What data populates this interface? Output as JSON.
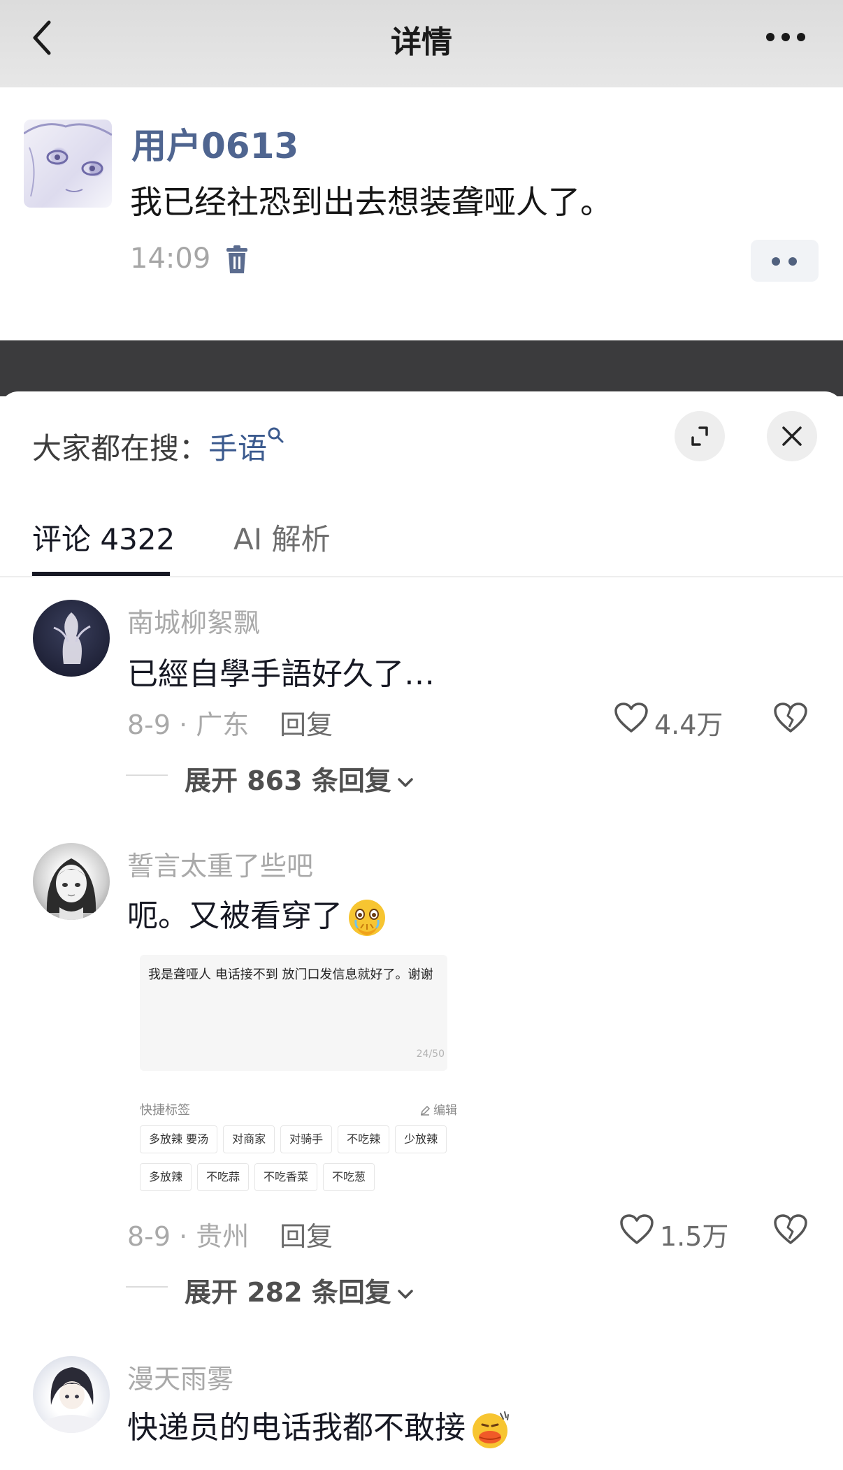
{
  "nav": {
    "title": "详情"
  },
  "post": {
    "username": "用户0613",
    "text": "我已经社恐到出去想装聋哑人了。",
    "time": "14:09"
  },
  "sheet": {
    "hot_search_prefix": "大家都在搜：",
    "hot_search_keyword": "手语",
    "tabs": [
      {
        "label": "评论 4322"
      },
      {
        "label": "AI 解析"
      }
    ]
  },
  "comments": [
    {
      "author": "南城柳絮飘",
      "text": "已經自學手語好久了…",
      "meta": "8-9 · 广东",
      "reply": "回复",
      "likes": "4.4万",
      "expand": "展开 863 条回复"
    },
    {
      "author": "誓言太重了些吧",
      "text": "呃。又被看穿了",
      "emoji": "crying-face-with-hands-over-mouth",
      "meta": "8-9 · 贵州",
      "reply": "回复",
      "likes": "1.5万",
      "expand": "展开 282 条回复",
      "image": {
        "text": "我是聋哑人 电话接不到 放门口发信息就好了。谢谢",
        "counter": "24/50",
        "label": "快捷标签",
        "edit": "编辑",
        "tags": [
          "多放辣 要汤",
          "对商家",
          "对骑手",
          "不吃辣",
          "少放辣",
          "多放辣",
          "不吃蒜",
          "不吃香菜",
          "不吃葱"
        ]
      }
    },
    {
      "author": "漫天雨雾",
      "text": "快递员的电话我都不敢接",
      "emoji": "duck-face-emoji"
    }
  ],
  "colors": {
    "username_blue": "#4f6590",
    "keyword_blue": "#3b5a8e",
    "muted_gray": "#a9a9a9",
    "dim_overlay": "#3b3b3d"
  }
}
